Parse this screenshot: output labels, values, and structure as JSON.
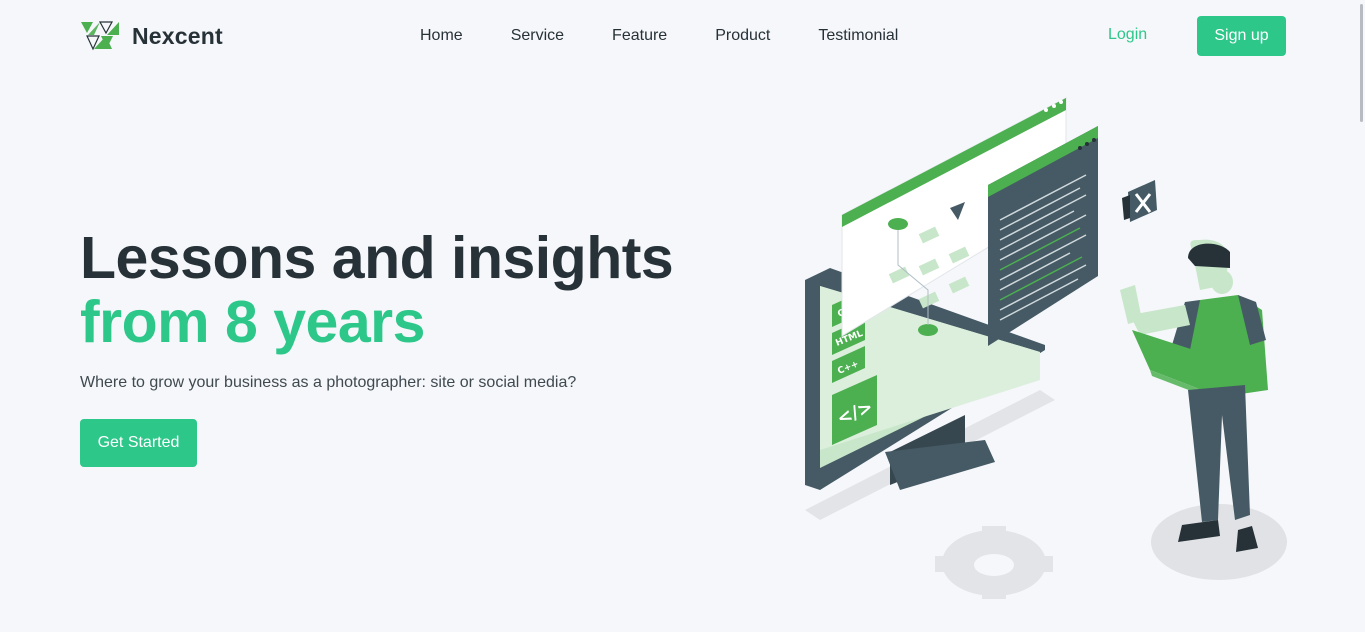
{
  "header": {
    "brand": "Nexcent",
    "nav": [
      "Home",
      "Service",
      "Feature",
      "Product",
      "Testimonial"
    ],
    "login_label": "Login",
    "signup_label": "Sign up"
  },
  "hero": {
    "title_line1": "Lessons and insights",
    "title_line2": "from 8 years",
    "subtitle": "Where to grow your business as a photographer: site or social media?",
    "cta_label": "Get Started"
  },
  "illustration": {
    "tags": [
      "CSS",
      "HTML",
      "C++"
    ],
    "code_symbol": "</>"
  },
  "colors": {
    "accent": "#2dc78a",
    "illustration_green": "#4caf50",
    "dark": "#263238",
    "slate": "#455a64",
    "background": "#f5f7fa"
  }
}
